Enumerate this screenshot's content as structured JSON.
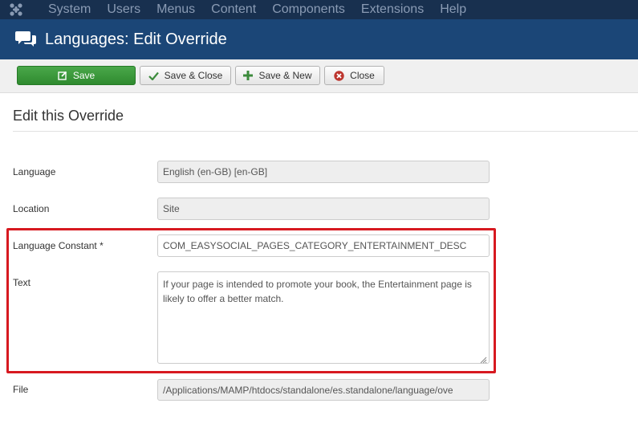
{
  "topnav": {
    "items": [
      "System",
      "Users",
      "Menus",
      "Content",
      "Components",
      "Extensions",
      "Help"
    ]
  },
  "header": {
    "title": "Languages: Edit Override"
  },
  "toolbar": {
    "save": "Save",
    "save_close": "Save & Close",
    "save_new": "Save & New",
    "close": "Close"
  },
  "form": {
    "section_title": "Edit this Override",
    "language_label": "Language",
    "language_value": "English (en-GB) [en-GB]",
    "location_label": "Location",
    "location_value": "Site",
    "constant_label": "Language Constant *",
    "constant_value": "COM_EASYSOCIAL_PAGES_CATEGORY_ENTERTAINMENT_DESC",
    "text_label": "Text",
    "text_value": "If your page is intended to promote your book, the Entertainment page is likely to offer a better match.",
    "file_label": "File",
    "file_value": "/Applications/MAMP/htdocs/standalone/es.standalone/language/ove"
  },
  "colors": {
    "topnav_bg": "#18304f",
    "header_bg": "#1b4677",
    "save_green": "#3c9a3c",
    "highlight_red": "#d71920"
  }
}
